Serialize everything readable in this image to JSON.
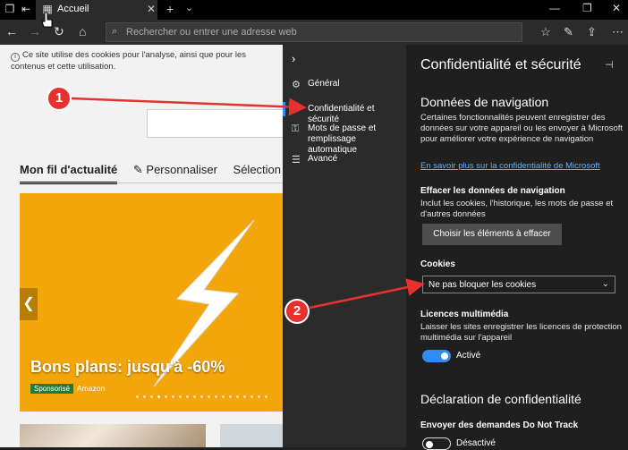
{
  "titlebar": {
    "tab_title": "Accueil",
    "close_glyph": "✕",
    "new_tab_glyph": "+",
    "tab_list_glyph": "⌄",
    "minimize_glyph": "—",
    "restore_glyph": "❐",
    "close_window_glyph": "✕"
  },
  "navbar": {
    "back_glyph": "←",
    "forward_glyph": "→",
    "refresh_glyph": "↻",
    "home_glyph": "⌂",
    "address_placeholder": "Rechercher ou entrer une adresse web",
    "more_glyph": "⋯"
  },
  "page": {
    "cookie_notice": "Ce site utilise des cookies pour l'analyse, ainsi que pour les contenus et cette utilisation.",
    "feed_tabs": [
      "Mon fil d'actualité",
      "Personnaliser",
      "Sélection de"
    ],
    "hero_title": "Bons plans: jusqu'à -60%",
    "sponsor_label": "Sponsorisé",
    "advertiser": "Amazon",
    "prev_glyph": "❮"
  },
  "settings_nav": {
    "items": [
      {
        "label": "Général",
        "icon": "gear-icon"
      },
      {
        "label": "Confidentialité et sécurité",
        "icon": "lock-icon"
      },
      {
        "label": "Mots de passe et remplissage automatique",
        "icon": "key-icon"
      },
      {
        "label": "Avancé",
        "icon": "sliders-icon"
      }
    ]
  },
  "panel": {
    "title": "Confidentialité et sécurité",
    "nav_data_heading": "Données de navigation",
    "nav_data_text": "Certaines fonctionnalités peuvent enregistrer des données sur votre appareil ou les envoyer à Microsoft pour améliorer votre expérience de navigation",
    "learn_more_link": "En savoir plus sur la confidentialité de Microsoft",
    "clear_label": "Effacer les données de navigation",
    "clear_text": "Inclut les cookies, l'historique, les mots de passe et d'autres données",
    "clear_button": "Choisir les éléments à effacer",
    "cookies_label": "Cookies",
    "cookies_value": "Ne pas bloquer les cookies",
    "media_label": "Licences multimédia",
    "media_text": "Laisser les sites enregistrer les licences de protection multimédia sur l'appareil",
    "media_toggle_state": "Activé",
    "privacy_heading": "Déclaration de confidentialité",
    "dnt_label": "Envoyer des demandes Do Not Track",
    "dnt_toggle_state": "Désactivé"
  },
  "annotations": {
    "badge1": "1",
    "badge2": "2",
    "arrow_color": "#e6312e"
  }
}
